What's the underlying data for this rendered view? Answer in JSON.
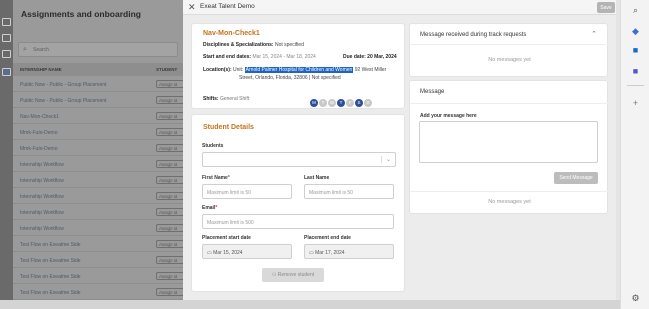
{
  "background": {
    "title": "Assignments and onboarding",
    "search_placeholder": "Search",
    "headers": [
      "INTERNSHIP NAME",
      "STUDENT"
    ],
    "rows": [
      "Public Now - Public - Group Placement",
      "Public Now - Public - Group Placement",
      "Nav-Mon-Check1",
      "Mmk-Futo-Demo",
      "Mmk-Futo-Demo",
      "Internship Workflow",
      "Internship Workflow",
      "Internship Workflow",
      "Internship Workflow",
      "Internship Workflow",
      "Test Flow on Exeatme Side",
      "Test Flow on Exeatme Side",
      "Test Flow on Exeatme Side",
      "Test Flow on Exeatme Side"
    ],
    "row_button": "Assign st"
  },
  "modal": {
    "title": "Exeat Talent Demo",
    "save_label": "Save",
    "close_icon": "close-icon",
    "details": {
      "name": "Nav-Mon-Check1",
      "disciplines_label": "Disciplines & Specializations:",
      "disciplines_value": "Not specified",
      "dates_label": "Start and end dates:",
      "dates_value": "Mar 15, 2024 - Mar 18, 2024",
      "due_label": "Due date:",
      "due_value": "20 Mar, 2024",
      "location_label": "Location(s):",
      "location_unit": "Unit:",
      "location_highlight": "Arnold Palmer Hospital for Children and Women",
      "location_rest1": "92 West Miller",
      "location_rest2": "Street, Orlando, Florida, 32806 | Not specified",
      "shifts_label": "Shifts:",
      "shifts_value": "General Shift",
      "days": [
        {
          "label": "M",
          "on": true
        },
        {
          "label": "T",
          "on": false
        },
        {
          "label": "W",
          "on": false
        },
        {
          "label": "T",
          "on": true
        },
        {
          "label": "F",
          "on": false
        },
        {
          "label": "S",
          "on": true
        },
        {
          "label": "S",
          "on": false
        }
      ]
    },
    "student_details": {
      "title": "Student Details",
      "students_label": "Students",
      "first_name_label": "First Name",
      "first_name_placeholder": "Maximum limit is 50",
      "last_name_label": "Last Name",
      "last_name_placeholder": "Maximum limit is 50",
      "email_label": "Email",
      "email_placeholder": "Maximum limit is 500",
      "start_label": "Placement start date",
      "start_value": "Mar 15, 2024",
      "end_label": "Placement end date",
      "end_value": "Mar 17, 2024",
      "remove_label": "Remove student"
    },
    "messages_received": {
      "title": "Message received during track requests",
      "empty": "No messages yet"
    },
    "message": {
      "title": "Message",
      "add_label": "Add your message here",
      "send_label": "Send Message",
      "empty": "No messages yet"
    }
  },
  "right_panel": {
    "icons": [
      "search-icon",
      "copilot-icon",
      "outlook-icon",
      "teams-icon",
      "add-icon",
      "settings-icon"
    ]
  }
}
